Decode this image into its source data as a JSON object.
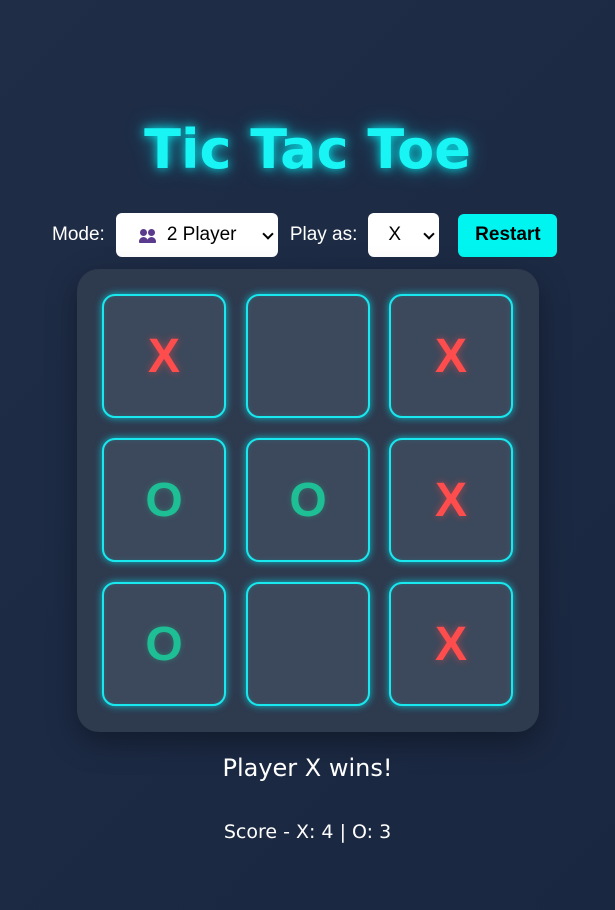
{
  "title": "Tic Tac Toe",
  "controls": {
    "mode_label": "Mode:",
    "mode_value": "2 Player",
    "mode_icon": "two-people-icon",
    "play_as_label": "Play as:",
    "play_as_value": "X",
    "restart_label": "Restart"
  },
  "board": {
    "cells": [
      "X",
      "",
      "X",
      "O",
      "O",
      "X",
      "O",
      "",
      "X"
    ]
  },
  "status": "Player X wins!",
  "score": "Score - X: 4 | O: 3",
  "colors": {
    "accent": "#00f5f0",
    "x_mark": "#ff4d4d",
    "o_mark": "#1fbf96",
    "background": "#1e2b45"
  }
}
